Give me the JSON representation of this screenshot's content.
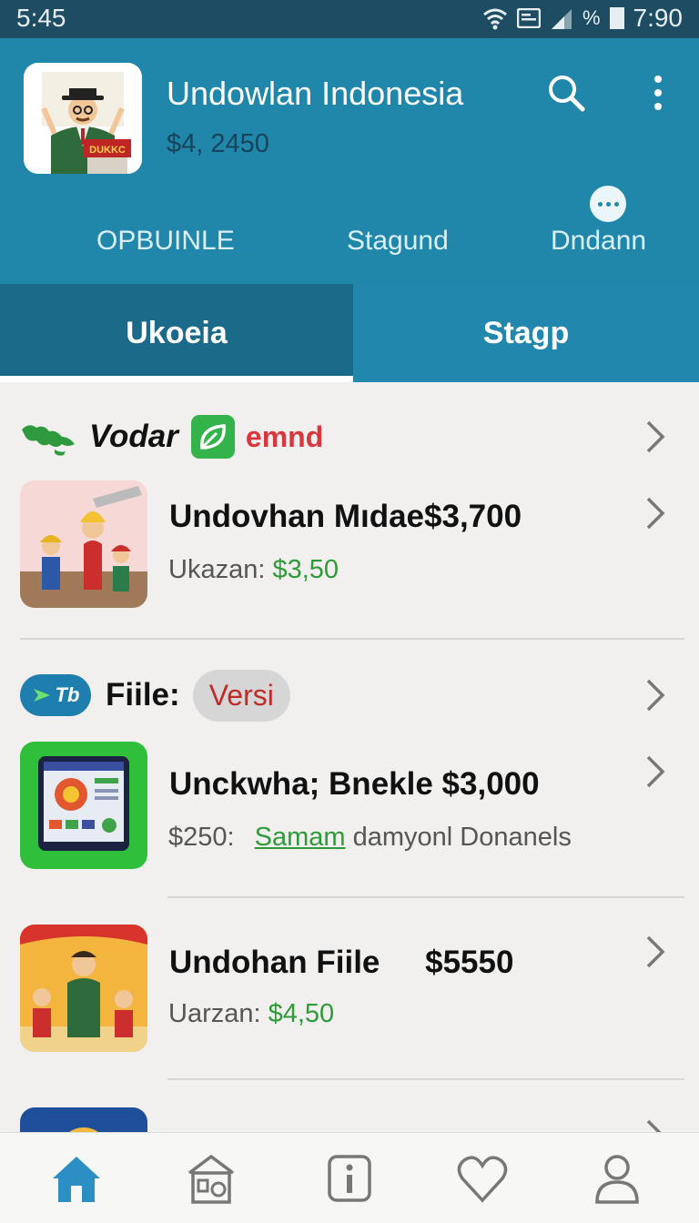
{
  "status_bar": {
    "time": "5:45",
    "battery_pct": "%",
    "clock": "7:90"
  },
  "app": {
    "title": "Undowlan Indonesia",
    "balance": "$4, 2450",
    "logo_sign": "DUKKC"
  },
  "top_tabs": [
    {
      "label": "OPBUINLE"
    },
    {
      "label": "Stagund"
    },
    {
      "label": "Dndann"
    }
  ],
  "segments": [
    {
      "label": "Ukoeia",
      "selected": true
    },
    {
      "label": "Stagp",
      "selected": false
    }
  ],
  "sections": [
    {
      "name": "Vodar",
      "tag": "emnd",
      "items": [
        {
          "title": "Undovhan Mıdae$3,700",
          "sub_label": "Ukazan:",
          "sub_value": "$3,50"
        }
      ]
    },
    {
      "badge_text": "Tb",
      "name": "Fiile:",
      "pill": "Versi",
      "items": [
        {
          "title": "Unckwha; Bnekle $3,000",
          "sub_label": "$250:",
          "sub_link": "Samam",
          "sub_rest": "damyonl Donanels"
        },
        {
          "title_name": "Undohan Fiile",
          "title_price": "$5550",
          "sub_label": "Uarzan:",
          "sub_value": "$4,50"
        }
      ]
    }
  ],
  "bottom_nav": [
    {
      "icon": "home-icon",
      "active": true
    },
    {
      "icon": "store-icon",
      "active": false
    },
    {
      "icon": "info-icon",
      "active": false
    },
    {
      "icon": "heart-icon",
      "active": false
    },
    {
      "icon": "profile-icon",
      "active": false
    }
  ],
  "colors": {
    "header": "#2087ab",
    "status_bar": "#1d4c63",
    "selected_segment": "#1b6a89",
    "price_green": "#2f9a3a",
    "tag_red": "#d9363e",
    "active_nav": "#2b8fc3"
  }
}
